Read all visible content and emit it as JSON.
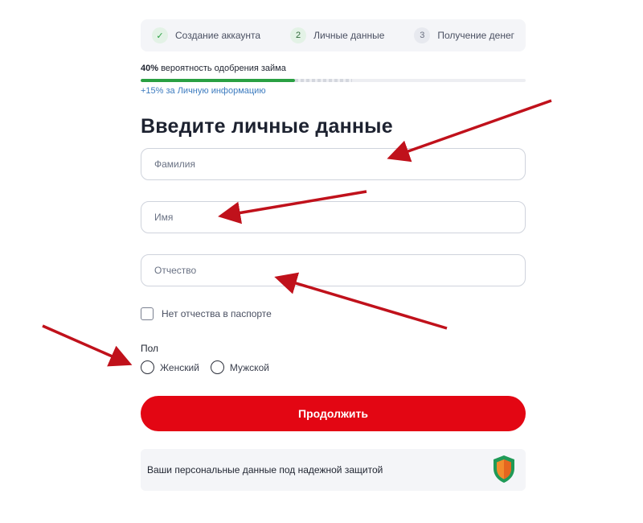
{
  "stepper": {
    "steps": [
      {
        "marker": "✓",
        "label": "Создание аккаунта"
      },
      {
        "marker": "2",
        "label": "Личные данные"
      },
      {
        "marker": "3",
        "label": "Получение денег"
      }
    ]
  },
  "approval": {
    "percent_value": 40,
    "percent": "40%",
    "text": " вероятность одобрения займа",
    "bonus": "+15% за Личную информацию"
  },
  "form": {
    "title": "Введите личные данные",
    "surname_placeholder": "Фамилия",
    "name_placeholder": "Имя",
    "patronymic_placeholder": "Отчество",
    "no_patronymic_label": "Нет отчества в паспорте",
    "gender_label": "Пол",
    "gender_options": [
      "Женский",
      "Мужской"
    ],
    "submit_label": "Продолжить"
  },
  "security_note": "Ваши персональные данные под надежной защитой",
  "colors": {
    "accent": "#e30613",
    "success": "#2aa043",
    "annotation_arrow": "#c0111b"
  },
  "icons": {
    "step_done": "check-icon",
    "security": "shield-icon"
  }
}
